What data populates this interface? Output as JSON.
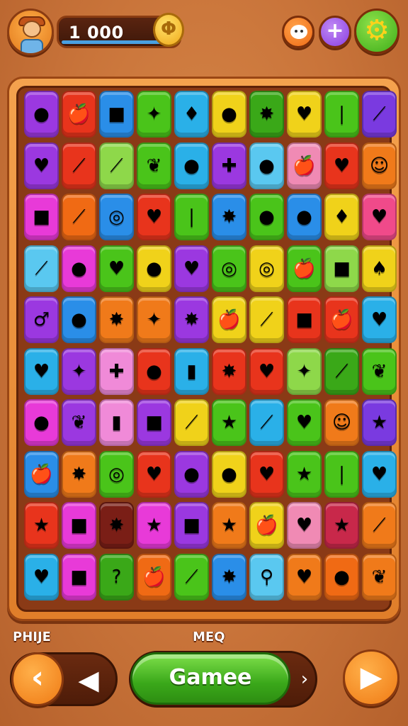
{
  "header": {
    "coins": "1 000",
    "coin_glyph": "Φ",
    "plus_glyph": "+",
    "gear_glyph": "⚙",
    "icons": [
      "avatar-icon",
      "coin-icon",
      "smiley-icon",
      "plus-icon",
      "gear-icon"
    ]
  },
  "board": {
    "rows": 10,
    "cols": 10,
    "tiles": [
      [
        {
          "c": "#9b38e0",
          "s": "●"
        },
        {
          "c": "#e8341c",
          "s": "🍎"
        },
        {
          "c": "#2a8ee8",
          "s": "■"
        },
        {
          "c": "#4ac41a",
          "s": "✦"
        },
        {
          "c": "#2ab0e8",
          "s": "♦"
        },
        {
          "c": "#f0d21a",
          "s": "●"
        },
        {
          "c": "#3aa818",
          "s": "✸"
        },
        {
          "c": "#f0d21a",
          "s": "♥"
        },
        {
          "c": "#4ac41a",
          "s": "❘"
        },
        {
          "c": "#7a3ae0",
          "s": "⟋"
        }
      ],
      [
        {
          "c": "#9b38e0",
          "s": "♥"
        },
        {
          "c": "#e8341c",
          "s": "⟋"
        },
        {
          "c": "#8ed84a",
          "s": "⟋"
        },
        {
          "c": "#4ac41a",
          "s": "❦"
        },
        {
          "c": "#2ab0e8",
          "s": "●"
        },
        {
          "c": "#9b38e0",
          "s": "✚"
        },
        {
          "c": "#5ac8f0",
          "s": "●"
        },
        {
          "c": "#f08ab4",
          "s": "🍎"
        },
        {
          "c": "#e8341c",
          "s": "♥"
        },
        {
          "c": "#f07a1a",
          "s": "☺"
        }
      ],
      [
        {
          "c": "#e83ad8",
          "s": "■"
        },
        {
          "c": "#f06a14",
          "s": "⟋"
        },
        {
          "c": "#2a8ee8",
          "s": "◎"
        },
        {
          "c": "#e8341c",
          "s": "♥"
        },
        {
          "c": "#4ac41a",
          "s": "❘"
        },
        {
          "c": "#2a8ee8",
          "s": "✸"
        },
        {
          "c": "#4ac41a",
          "s": "●"
        },
        {
          "c": "#2a8ee8",
          "s": "●"
        },
        {
          "c": "#f0d21a",
          "s": "♦"
        },
        {
          "c": "#f04a8a",
          "s": "♥"
        }
      ],
      [
        {
          "c": "#5ac8f0",
          "s": "⟋"
        },
        {
          "c": "#e83ad8",
          "s": "●"
        },
        {
          "c": "#4ac41a",
          "s": "♥"
        },
        {
          "c": "#f0d21a",
          "s": "●"
        },
        {
          "c": "#9b38e0",
          "s": "♥"
        },
        {
          "c": "#4ac41a",
          "s": "◎"
        },
        {
          "c": "#f0d21a",
          "s": "◎"
        },
        {
          "c": "#4ac41a",
          "s": "🍎"
        },
        {
          "c": "#8ed84a",
          "s": "■"
        },
        {
          "c": "#f0d21a",
          "s": "♠"
        }
      ],
      [
        {
          "c": "#9b38e0",
          "s": "♂"
        },
        {
          "c": "#2a8ee8",
          "s": "●"
        },
        {
          "c": "#f07a1a",
          "s": "✸"
        },
        {
          "c": "#f07a1a",
          "s": "✦"
        },
        {
          "c": "#9b38e0",
          "s": "✸"
        },
        {
          "c": "#f0d21a",
          "s": "🍎"
        },
        {
          "c": "#f0d21a",
          "s": "⟋"
        },
        {
          "c": "#e8341c",
          "s": "■"
        },
        {
          "c": "#e8341c",
          "s": "🍎"
        },
        {
          "c": "#2ab0e8",
          "s": "♥"
        }
      ],
      [
        {
          "c": "#2ab0e8",
          "s": "♥"
        },
        {
          "c": "#9b38e0",
          "s": "✦"
        },
        {
          "c": "#f08ad8",
          "s": "✚"
        },
        {
          "c": "#e8341c",
          "s": "●"
        },
        {
          "c": "#2ab0e8",
          "s": "▮"
        },
        {
          "c": "#e8341c",
          "s": "✸"
        },
        {
          "c": "#e8341c",
          "s": "♥"
        },
        {
          "c": "#8ed84a",
          "s": "✦"
        },
        {
          "c": "#3aa818",
          "s": "⟋"
        },
        {
          "c": "#4ac41a",
          "s": "❦"
        }
      ],
      [
        {
          "c": "#e83ad8",
          "s": "●"
        },
        {
          "c": "#9b38e0",
          "s": "❦"
        },
        {
          "c": "#f08ad8",
          "s": "▮"
        },
        {
          "c": "#9b38e0",
          "s": "■"
        },
        {
          "c": "#f0d21a",
          "s": "⟋"
        },
        {
          "c": "#4ac41a",
          "s": "★"
        },
        {
          "c": "#2ab0e8",
          "s": "⟋"
        },
        {
          "c": "#4ac41a",
          "s": "♥"
        },
        {
          "c": "#f07a1a",
          "s": "☺"
        },
        {
          "c": "#7a3ae0",
          "s": "★"
        }
      ],
      [
        {
          "c": "#2a8ee8",
          "s": "🍎"
        },
        {
          "c": "#f07a1a",
          "s": "✸"
        },
        {
          "c": "#4ac41a",
          "s": "◎"
        },
        {
          "c": "#e8341c",
          "s": "♥"
        },
        {
          "c": "#9b38e0",
          "s": "●"
        },
        {
          "c": "#f0d21a",
          "s": "●"
        },
        {
          "c": "#e8341c",
          "s": "♥"
        },
        {
          "c": "#4ac41a",
          "s": "★"
        },
        {
          "c": "#4ac41a",
          "s": "❘"
        },
        {
          "c": "#2ab0e8",
          "s": "♥"
        }
      ],
      [
        {
          "c": "#e8341c",
          "s": "★"
        },
        {
          "c": "#e83ad8",
          "s": "■"
        },
        {
          "c": "#7a1e16",
          "s": "✸"
        },
        {
          "c": "#e83ad8",
          "s": "★"
        },
        {
          "c": "#9b38e0",
          "s": "■"
        },
        {
          "c": "#f07a1a",
          "s": "★"
        },
        {
          "c": "#f0d21a",
          "s": "🍎"
        },
        {
          "c": "#f08ab4",
          "s": "♥"
        },
        {
          "c": "#c8284a",
          "s": "★"
        },
        {
          "c": "#f07a1a",
          "s": "⟋"
        }
      ],
      [
        {
          "c": "#2ab0e8",
          "s": "♥"
        },
        {
          "c": "#e83ad8",
          "s": "■"
        },
        {
          "c": "#3aa818",
          "s": "?"
        },
        {
          "c": "#f06a14",
          "s": "🍎"
        },
        {
          "c": "#4ac41a",
          "s": "⟋"
        },
        {
          "c": "#2a8ee8",
          "s": "✸"
        },
        {
          "c": "#5ac8f0",
          "s": "⚲"
        },
        {
          "c": "#f07a1a",
          "s": "♥"
        },
        {
          "c": "#f06a14",
          "s": "●"
        },
        {
          "c": "#f07a1a",
          "s": "❦"
        }
      ]
    ]
  },
  "footer": {
    "left_label": "PHIJE",
    "mid_label": "MEQ",
    "prev_glyph": "‹",
    "back_glyph": "◀",
    "game_label": "Gamee",
    "chevron_glyph": "›",
    "next_glyph": "▶"
  }
}
